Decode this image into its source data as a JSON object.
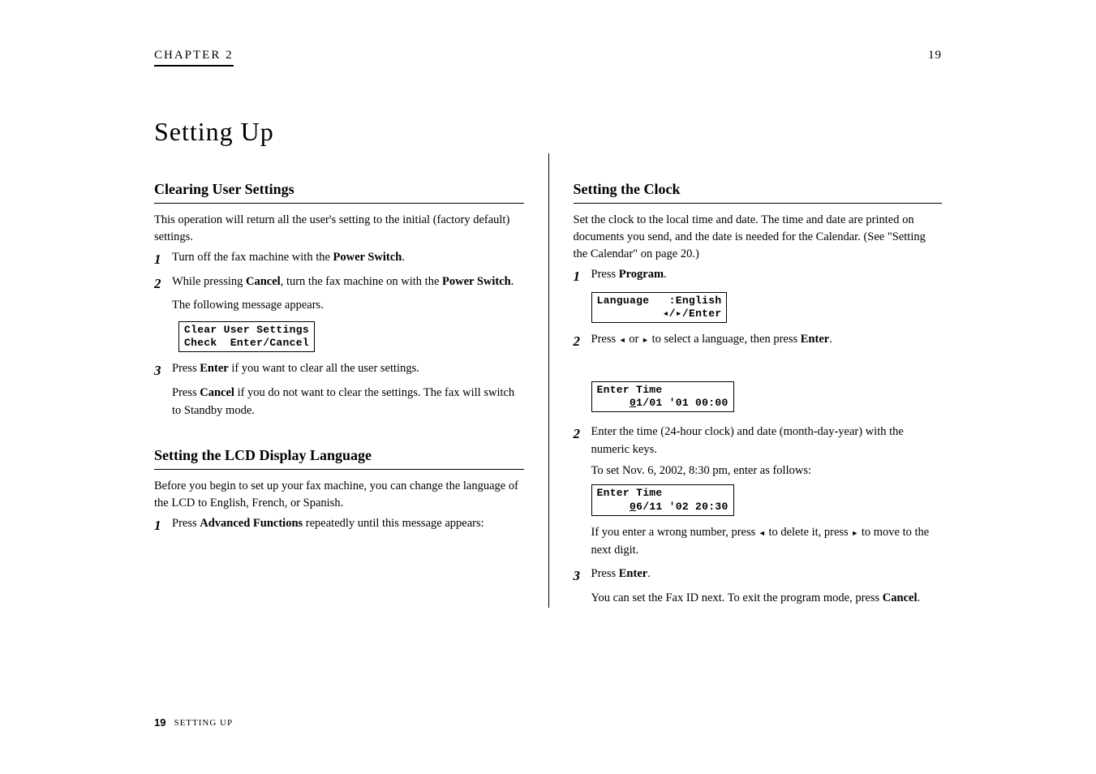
{
  "header": {
    "chapter": "CHAPTER 2",
    "page_top": "19"
  },
  "title": "Setting Up",
  "left": {
    "sec1_heading": "Clearing User Settings",
    "sec1_p1": "This operation will return all the user's setting to the initial (factory default) settings.",
    "step1_num": "1",
    "step1_body_pre": "Turn off the fax machine with the ",
    "step1_body_b": "Power Switch",
    "step1_body_post": ".",
    "step2_num": "2",
    "step2_body_pre": "While pressing ",
    "step2_body_b": "Cancel",
    "step2_body_post": ", turn the fax machine on with the ",
    "step2_body_b2": "Power Switch",
    "step2_body_post2": ".",
    "sub1": "The following message appears.",
    "lcd1_l1": "Clear User Settings",
    "lcd1_l2": "Check  Enter/Cancel",
    "step3_num": "3",
    "step3_pre": "Press ",
    "step3_b": "Enter",
    "step3_post": " if you want to clear all the user settings.",
    "sub2_pre": "Press ",
    "sub2_b": "Cancel",
    "sub2_post": " if you do not want to clear the settings. The fax will switch to Standby mode.",
    "sec2_heading": "Setting the LCD Display Language",
    "sec2_p": "Before you begin to set up your fax machine, you can change the language of the LCD to English, French, or Spanish.",
    "stepR1_num": "1",
    "stepR1_pre": "Press ",
    "stepR1_b": "Advanced Functions",
    "stepR1_post": " repeatedly until this message appears:",
    "lcdR1_l1": "Language   :English",
    "lcdR1_l2": "          ◂/▸/Enter",
    "stepR2_num": "2",
    "stepR2_pre": "Press ",
    "stepR2_mid": " or ",
    "stepR2_post": " to select a language, then press ",
    "stepR2_b": "Enter",
    "stepR2_post2": "."
  },
  "right": {
    "sec_heading": "Setting the Clock",
    "sec_p": "Set the clock to the local time and date. The time and date are printed on documents you send, and the date is needed for the Calendar. (See \"Setting the Calendar\" on page 20.)",
    "step1_num": "1",
    "step1_pre": "Press ",
    "step1_b": "Program",
    "step1_post": ".",
    "lcd1_l1": "Enter Time",
    "lcd1_l2_pre": "     ",
    "lcd1_l2_u": "0",
    "lcd1_l2_rest": "1/01 '01 00:00",
    "step2_num": "2",
    "step2_body": "Enter the time (24-hour clock) and date (month-day-year) with the numeric keys.",
    "sub1": "To set Nov. 6, 2002, 8:30 pm, enter as follows:",
    "lcd2_l1": "Enter Time",
    "lcd2_l2_pre": "     ",
    "lcd2_l2_u": "0",
    "lcd2_l2_rest": "6/11 '02 20:30",
    "sub2_pre": "If you enter a wrong number, press ",
    "sub2_mid": " to delete it, press ",
    "sub2_post": " to move to the next digit.",
    "step3_num": "3",
    "step3_pre": "Press ",
    "step3_b": "Enter",
    "step3_post": ".",
    "sub3": "You can set the Fax ID next. To exit the program mode, press ",
    "sub3_b": "Cancel",
    "sub3_post": "."
  },
  "footer": {
    "page": "19",
    "crumb": "SETTING   UP"
  }
}
